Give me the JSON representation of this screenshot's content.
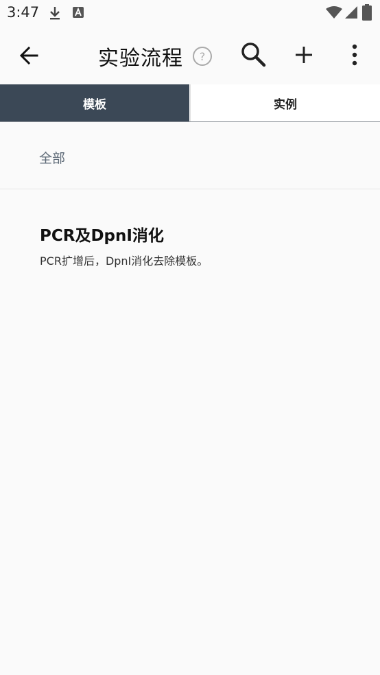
{
  "status_bar": {
    "time": "3:47",
    "icons": [
      "download-icon",
      "font-icon",
      "wifi-icon",
      "signal-icon",
      "battery-icon"
    ]
  },
  "app_bar": {
    "title": "实验流程",
    "help_symbol": "?",
    "actions": [
      "back-arrow-icon",
      "help-icon",
      "search-icon",
      "plus-icon",
      "more-vert-icon"
    ]
  },
  "tabs": [
    {
      "label": "模板",
      "active": true
    },
    {
      "label": "实例",
      "active": false
    }
  ],
  "filter": {
    "label": "全部"
  },
  "items": [
    {
      "title": "PCR及DpnI消化",
      "description": "PCR扩增后，DpnI消化去除模板。"
    }
  ],
  "colors": {
    "tab_active_bg": "#3b4856",
    "background": "#fafafa",
    "filter_text": "#5f6b78"
  }
}
